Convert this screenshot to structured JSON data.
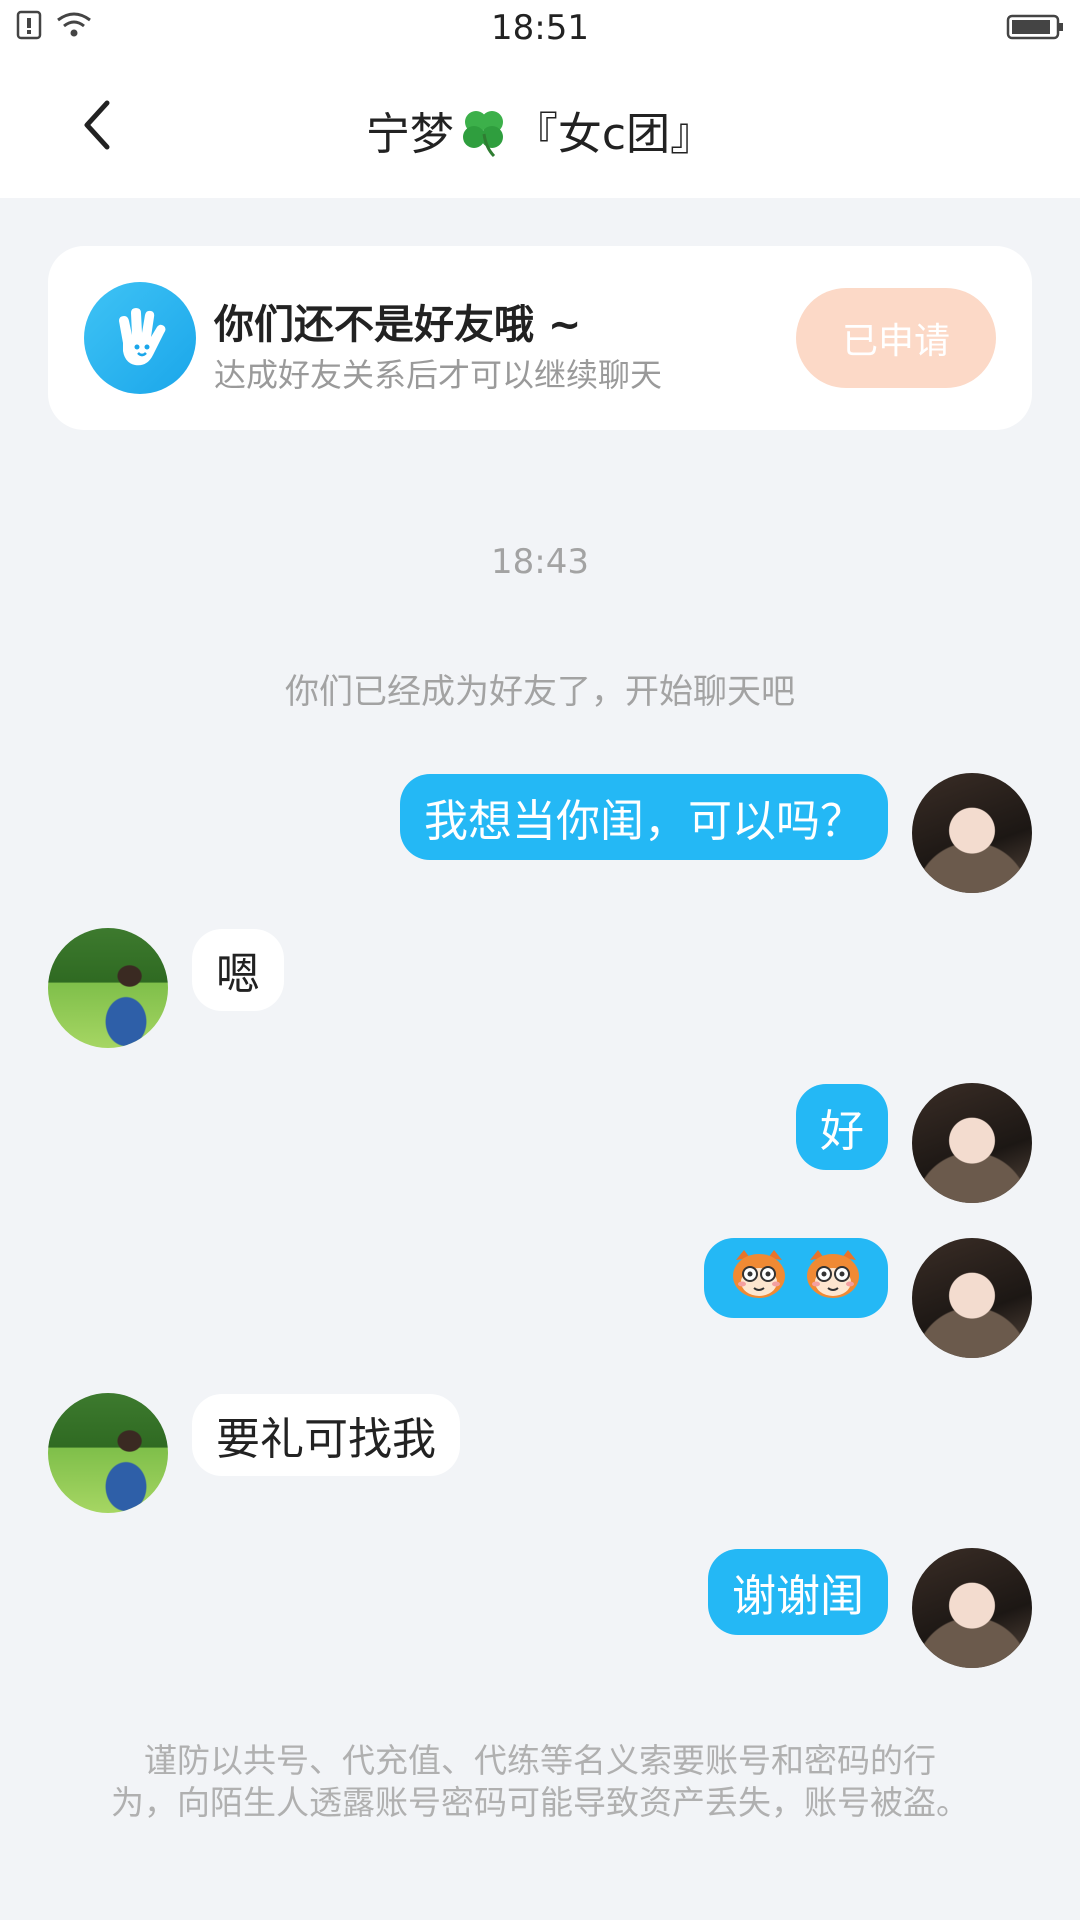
{
  "status_bar": {
    "time": "18:51"
  },
  "header": {
    "title_left": "宁梦",
    "title_right": "『女c团』",
    "title_emoji": "clover-emoji"
  },
  "friend_card": {
    "title": "你们还不是好友哦 ~",
    "subtitle": "达成好友关系后才可以继续聊天",
    "button_label": "已申请"
  },
  "chat": {
    "timestamp": "18:43",
    "system_message": "你们已经成为好友了，开始聊天吧",
    "messages": [
      {
        "sender": "self",
        "text": "我想当你闺，可以吗？"
      },
      {
        "sender": "peer",
        "text": "嗯"
      },
      {
        "sender": "self",
        "text": "好"
      },
      {
        "sender": "self",
        "type": "emoji",
        "emojis": [
          "monkey-face-emoji",
          "monkey-face-emoji"
        ]
      },
      {
        "sender": "peer",
        "text": "要礼可找我"
      },
      {
        "sender": "self",
        "text": "谢谢闺"
      }
    ]
  },
  "notice": {
    "line1": "谨防以共号、代充值、代练等名义索要账号和密码的行",
    "line2": "为，向陌生人透露账号密码可能导致资产丢失，账号被盗。"
  },
  "colors": {
    "self_bubble": "#24b8f5",
    "button_bg": "#fcd9c7",
    "background": "#f2f4f7"
  }
}
